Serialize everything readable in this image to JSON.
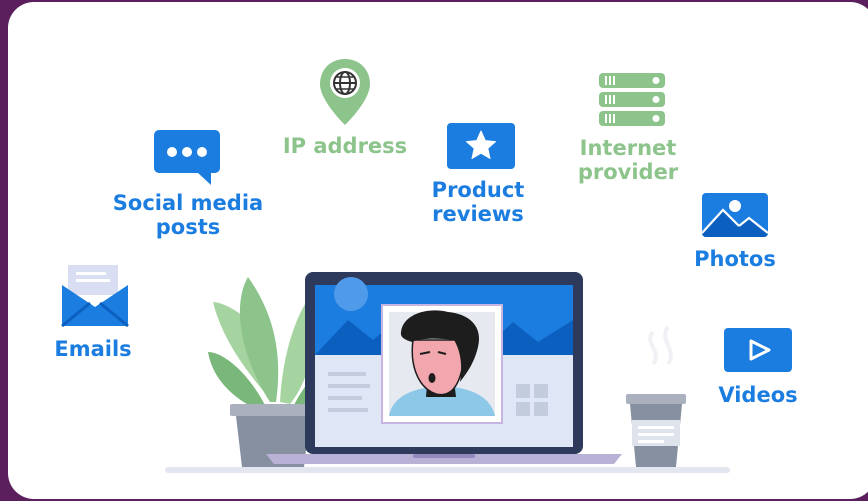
{
  "colors": {
    "frame": "#5c1f5e",
    "card": "#ffffff",
    "blue": "#1b7de0",
    "green": "#8cc48c"
  },
  "items": {
    "social": {
      "line1": "Social media",
      "line2": "posts",
      "icon": "chat-bubble-icon"
    },
    "ip": {
      "label": "IP address",
      "icon": "location-globe-icon"
    },
    "reviews": {
      "line1": "Product",
      "line2": "reviews",
      "icon": "star-icon"
    },
    "provider": {
      "line1": "Internet",
      "line2": "provider",
      "icon": "server-icon"
    },
    "photos": {
      "label": "Photos",
      "icon": "image-icon"
    },
    "emails": {
      "label": "Emails",
      "icon": "envelope-icon"
    },
    "videos": {
      "label": "Videos",
      "icon": "play-icon"
    }
  }
}
